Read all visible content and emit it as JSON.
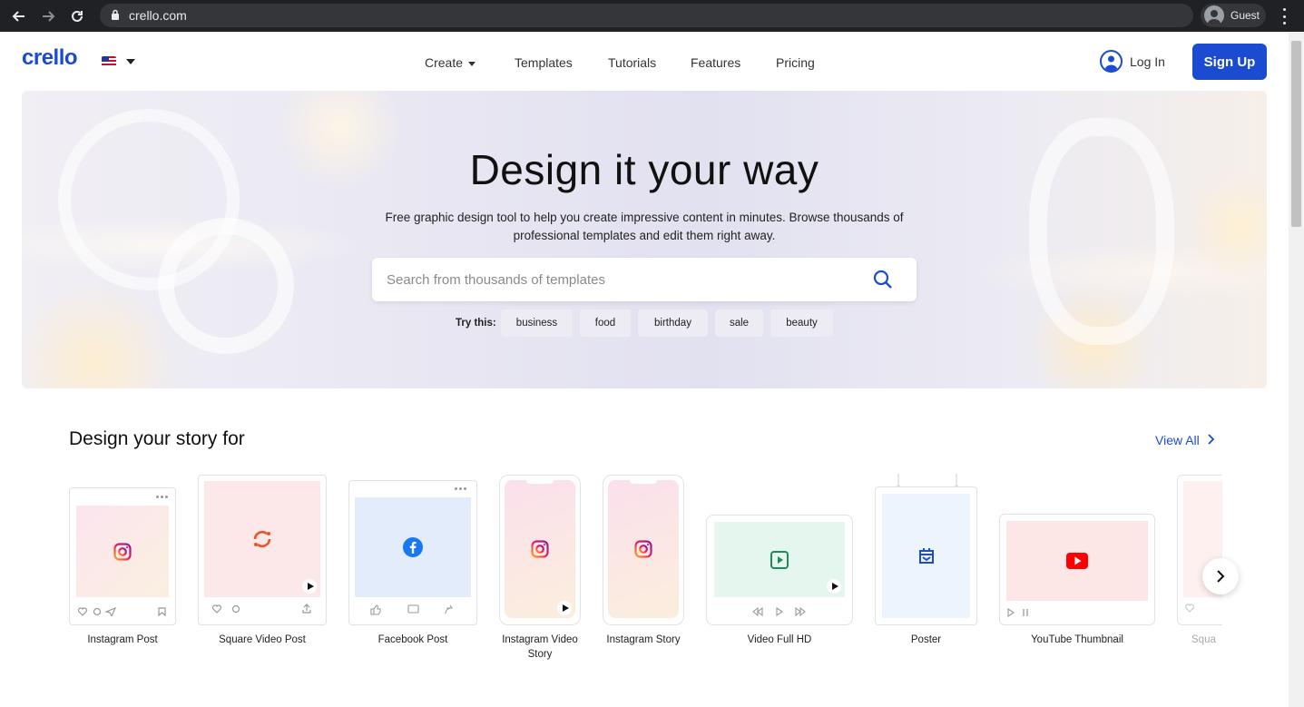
{
  "browser": {
    "url": "crello.com",
    "profile_label": "Guest"
  },
  "header": {
    "logo": "crello",
    "nav": {
      "create": "Create",
      "templates": "Templates",
      "tutorials": "Tutorials",
      "features": "Features",
      "pricing": "Pricing"
    },
    "login": "Log In",
    "signup": "Sign Up"
  },
  "hero": {
    "title": "Design it your way",
    "subtitle": "Free graphic design tool to help you create impressive content in minutes. Browse thousands of professional templates and edit them right away.",
    "search_placeholder": "Search from thousands of templates",
    "try_label": "Try this:",
    "chips": [
      "business",
      "food",
      "birthday",
      "sale",
      "beauty"
    ]
  },
  "section": {
    "title": "Design your story for",
    "view_all": "View All",
    "cards": [
      "Instagram Post",
      "Square Video Post",
      "Facebook Post",
      "Instagram Video Story",
      "Instagram Story",
      "Video Full HD",
      "Poster",
      "YouTube Thumbnail",
      "Squa"
    ]
  },
  "colors": {
    "brand": "#1b4bd1",
    "chrome_bg": "#202124"
  }
}
